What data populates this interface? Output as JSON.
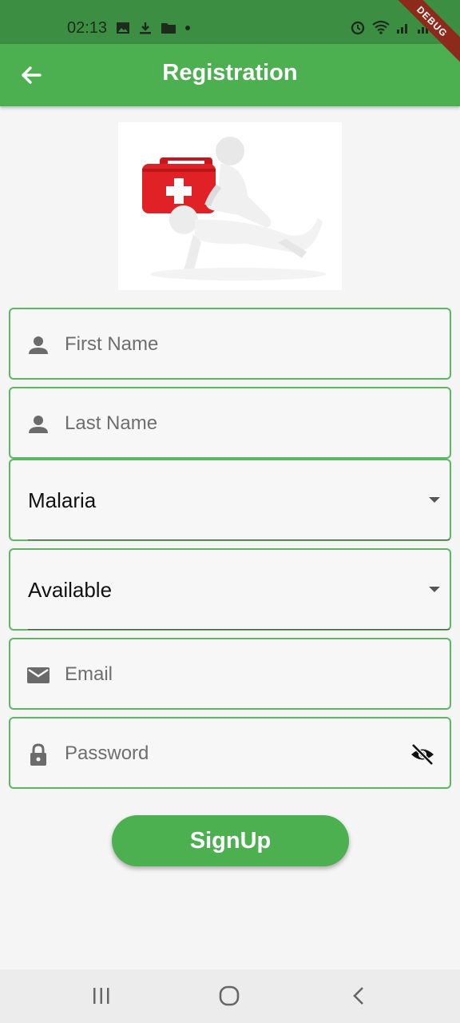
{
  "status_bar": {
    "time": "02:13"
  },
  "debug_banner": "DEBUG",
  "app_bar": {
    "title": "Registration"
  },
  "form": {
    "first_name_placeholder": "First Name",
    "last_name_placeholder": "Last Name",
    "disease_value": "Malaria",
    "availability_value": "Available",
    "email_placeholder": "Email",
    "password_placeholder": "Password",
    "signup_label": "SignUp"
  },
  "colors": {
    "primary": "#4caf50",
    "status_bar": "#3c8f42",
    "field_border": "#5cb85f",
    "debug": "#8c2a1c"
  }
}
